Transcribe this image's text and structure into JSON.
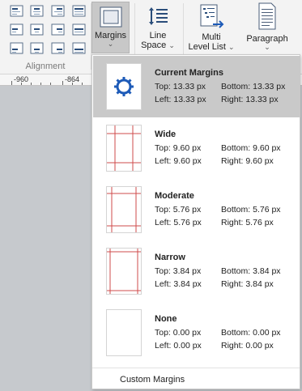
{
  "ribbon": {
    "alignment_label": "Alignment",
    "margins_label": "Margins",
    "line_space_label_1": "Line",
    "line_space_label_2": "Space",
    "multi_level_label_1": "Multi",
    "multi_level_label_2": "Level List",
    "paragraph_label": "Paragraph",
    "chevron": "⌄"
  },
  "ruler": {
    "labels": [
      "-960",
      "-864"
    ]
  },
  "margins_menu": {
    "current": {
      "title": "Current Margins",
      "top": "Top: 13.33 px",
      "bottom": "Bottom: 13.33 px",
      "left": "Left: 13.33 px",
      "right": "Right: 13.33 px",
      "icon": "gear-icon"
    },
    "options": [
      {
        "title": "Wide",
        "top": "Top: 9.60 px",
        "bottom": "Bottom: 9.60 px",
        "left": "Left: 9.60 px",
        "right": "Right: 9.60 px"
      },
      {
        "title": "Moderate",
        "top": "Top: 5.76 px",
        "bottom": "Bottom: 5.76 px",
        "left": "Left: 5.76 px",
        "right": "Right: 5.76 px"
      },
      {
        "title": "Narrow",
        "top": "Top: 3.84 px",
        "bottom": "Bottom: 3.84 px",
        "left": "Left: 3.84 px",
        "right": "Right: 3.84 px"
      },
      {
        "title": "None",
        "top": "Top: 0.00 px",
        "bottom": "Bottom: 0.00 px",
        "left": "Left: 0.00 px",
        "right": "Right: 0.00 px"
      }
    ],
    "custom_label": "Custom Margins"
  },
  "colors": {
    "margin_line": "#cf4b4b",
    "selected_bg": "#c9c9c9",
    "ribbon_bg": "#f3f3f3"
  }
}
